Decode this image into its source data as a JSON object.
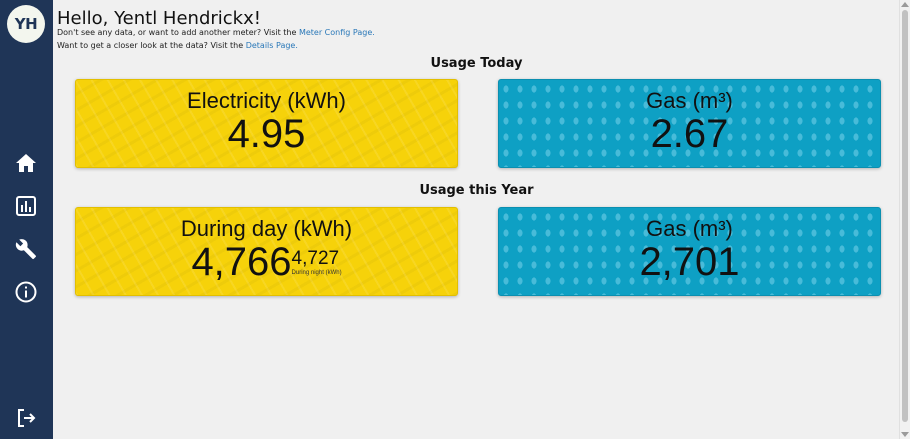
{
  "user": {
    "initials": "YH"
  },
  "sidebar": {
    "items": [
      {
        "icon": "home-icon"
      },
      {
        "icon": "chart-icon"
      },
      {
        "icon": "wrench-icon"
      },
      {
        "icon": "info-icon"
      }
    ],
    "logout_icon": "logout-icon",
    "color": "#1f3557"
  },
  "header": {
    "greeting": "Hello, Yentl Hendrickx!",
    "line1_text": "Don't see any data, or want to add another meter? Visit the ",
    "line1_link": "Meter Config Page.",
    "line2_text": "Want to get a closer look at the data? Visit the ",
    "line2_link": "Details Page."
  },
  "today": {
    "title": "Usage Today",
    "electricity": {
      "label": "Electricity (kWh)",
      "value": "4.95"
    },
    "gas": {
      "label": "Gas (m³)",
      "value": "2.67"
    }
  },
  "year": {
    "title": "Usage this Year",
    "electricity": {
      "label": "During day (kWh)",
      "value": "4,766",
      "night_value": "4,727",
      "night_label": "During night (kWh)"
    },
    "gas": {
      "label": "Gas (m³)",
      "value": "2,701"
    }
  },
  "colors": {
    "electricity": "#f6d20a",
    "gas": "#0ea0c4",
    "link": "#2a78b8"
  }
}
